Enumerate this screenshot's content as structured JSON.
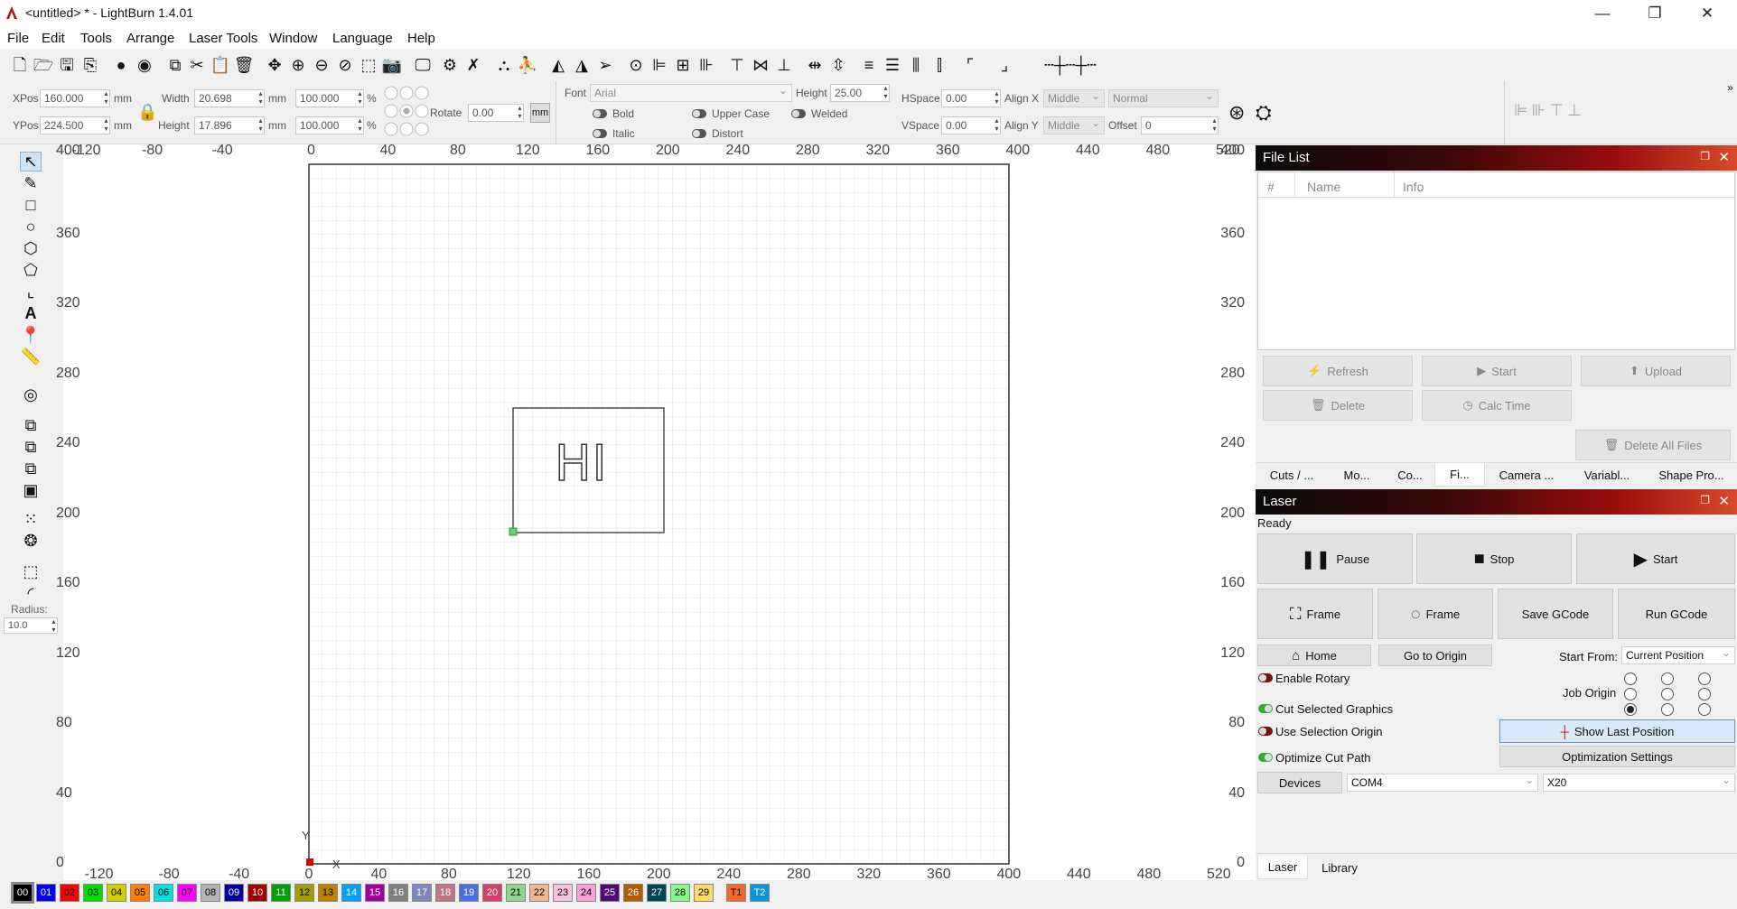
{
  "window": {
    "title": "<untitled> * - LightBurn 1.4.01",
    "min": "—",
    "max": "❐",
    "close": "✕"
  },
  "menu": [
    "File",
    "Edit",
    "Tools",
    "Arrange",
    "Laser Tools",
    "Window",
    "Language",
    "Help"
  ],
  "props": {
    "xpos_label": "XPos",
    "xpos": "160.000",
    "ypos_label": "YPos",
    "ypos": "224.500",
    "unit": "mm",
    "width_label": "Width",
    "width": "20.698",
    "height_label": "Height",
    "height": "17.896",
    "scale_w": "100.000",
    "scale_h": "100.000",
    "pct": "%",
    "rotate_label": "Rotate",
    "rotate": "0.00",
    "mm_toggle": "mm",
    "font_label": "Font",
    "font": "Arial",
    "theight_label": "Height",
    "theight": "25.00",
    "bold": "Bold",
    "italic": "Italic",
    "upper": "Upper Case",
    "distort": "Distort",
    "welded": "Welded",
    "hspace_label": "HSpace",
    "hspace": "0.00",
    "vspace_label": "VSpace",
    "vspace": "0.00",
    "alignx_label": "Align X",
    "alignx": "Middle",
    "aligny_label": "Align Y",
    "aligny": "Middle",
    "style": "Normal",
    "offset_label": "Offset",
    "offset": "0"
  },
  "left": {
    "radius_label": "Radius:",
    "radius": "10.0"
  },
  "canvas": {
    "x_ticks": [
      "-120",
      "-80",
      "-40",
      "0",
      "40",
      "80",
      "120",
      "160",
      "200",
      "240",
      "280",
      "320",
      "360",
      "400",
      "440",
      "480",
      "520"
    ],
    "y_ticks": [
      "400",
      "360",
      "320",
      "280",
      "240",
      "200",
      "160",
      "120",
      "80",
      "40",
      "0"
    ],
    "text": "HI",
    "x_axis": "X",
    "y_axis": "Y"
  },
  "filelist": {
    "title": "File List",
    "col_num": "#",
    "col_name": "Name",
    "col_info": "Info",
    "refresh": "Refresh",
    "start": "Start",
    "upload": "Upload",
    "delete": "Delete",
    "calc": "Calc Time",
    "delete_all": "Delete All Files",
    "tabs": [
      "Cuts / ...",
      "Mo...",
      "Co...",
      "Fi...",
      "Camera ...",
      "Variabl...",
      "Shape Pro..."
    ]
  },
  "laser": {
    "title": "Laser",
    "status": "Ready",
    "pause": "Pause",
    "stop": "Stop",
    "start": "Start",
    "frame1": "Frame",
    "frame2": "Frame",
    "save_gcode": "Save GCode",
    "run_gcode": "Run GCode",
    "home": "Home",
    "go_origin": "Go to Origin",
    "start_from_label": "Start From:",
    "start_from": "Current Position",
    "enable_rotary": "Enable Rotary",
    "job_origin": "Job Origin",
    "cut_selected": "Cut Selected Graphics",
    "use_sel_origin": "Use Selection Origin",
    "show_last": "Show Last Position",
    "optimize": "Optimize Cut Path",
    "opt_settings": "Optimization Settings",
    "devices": "Devices",
    "port": "COM4",
    "device": "X20",
    "bottom_tabs": [
      "Laser",
      "Library"
    ]
  },
  "palette": [
    {
      "l": "00",
      "c": "#000000",
      "t": "#ffffff"
    },
    {
      "l": "01",
      "c": "#0000ff",
      "t": "#ffffff"
    },
    {
      "l": "02",
      "c": "#ff0000",
      "t": "#000000"
    },
    {
      "l": "03",
      "c": "#00e000",
      "t": "#000000"
    },
    {
      "l": "04",
      "c": "#d0d000",
      "t": "#000000"
    },
    {
      "l": "05",
      "c": "#ff8000",
      "t": "#000000"
    },
    {
      "l": "06",
      "c": "#00e0e0",
      "t": "#000000"
    },
    {
      "l": "07",
      "c": "#ff00ff",
      "t": "#000000"
    },
    {
      "l": "08",
      "c": "#b4b4b4",
      "t": "#000000"
    },
    {
      "l": "09",
      "c": "#0000a0",
      "t": "#ffffff"
    },
    {
      "l": "10",
      "c": "#a00000",
      "t": "#ffffff"
    },
    {
      "l": "11",
      "c": "#00a000",
      "t": "#ffffff"
    },
    {
      "l": "12",
      "c": "#a0a000",
      "t": "#000000"
    },
    {
      "l": "13",
      "c": "#c08000",
      "t": "#000000"
    },
    {
      "l": "14",
      "c": "#00a0ff",
      "t": "#ffffff"
    },
    {
      "l": "15",
      "c": "#a000a0",
      "t": "#ffffff"
    },
    {
      "l": "16",
      "c": "#808080",
      "t": "#ffffff"
    },
    {
      "l": "17",
      "c": "#7d87b9",
      "t": "#ffffff"
    },
    {
      "l": "18",
      "c": "#bb7784",
      "t": "#ffffff"
    },
    {
      "l": "19",
      "c": "#4a6fe3",
      "t": "#ffffff"
    },
    {
      "l": "20",
      "c": "#d33f6a",
      "t": "#ffffff"
    },
    {
      "l": "21",
      "c": "#8cd78c",
      "t": "#000000"
    },
    {
      "l": "22",
      "c": "#f0b98d",
      "t": "#000000"
    },
    {
      "l": "23",
      "c": "#f6c4e1",
      "t": "#000000"
    },
    {
      "l": "24",
      "c": "#fa9ed4",
      "t": "#000000"
    },
    {
      "l": "25",
      "c": "#500a78",
      "t": "#ffffff"
    },
    {
      "l": "26",
      "c": "#b45a00",
      "t": "#ffffff"
    },
    {
      "l": "27",
      "c": "#004754",
      "t": "#ffffff"
    },
    {
      "l": "28",
      "c": "#86fa88",
      "t": "#000000"
    },
    {
      "l": "29",
      "c": "#ffdb66",
      "t": "#000000"
    },
    {
      "l": "T1",
      "c": "#f36926",
      "t": "#000000"
    },
    {
      "l": "T2",
      "c": "#0c96d9",
      "t": "#ffffff"
    }
  ]
}
